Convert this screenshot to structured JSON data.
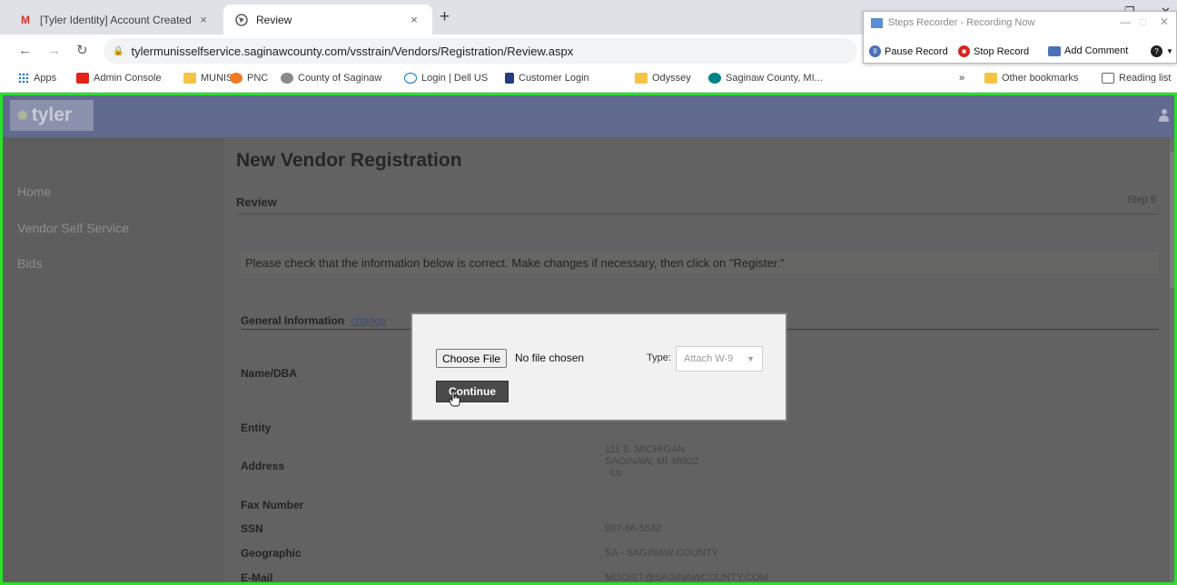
{
  "browser": {
    "tabs": [
      {
        "title": "[Tyler Identity] Account Created",
        "icon": "gmail-icon",
        "active": false
      },
      {
        "title": "Review",
        "icon": "globe-icon",
        "active": true
      }
    ],
    "new_tab_symbol": "+",
    "close_symbol": "×",
    "url": "tylermunisselfservice.saginawcounty.com/vsstrain/Vendors/Registration/Review.aspx",
    "bookmarks": [
      {
        "label": "Apps",
        "icon": "apps-grid-icon"
      },
      {
        "label": "Admin Console",
        "icon": "adobe-icon"
      },
      {
        "label": "MUNIS",
        "icon": "folder-icon"
      },
      {
        "label": "PNC",
        "icon": "pnc-icon"
      },
      {
        "label": "County of Saginaw",
        "icon": "county-seal-icon"
      },
      {
        "label": "Login | Dell US",
        "icon": "dell-icon"
      },
      {
        "label": "Customer Login",
        "icon": "paypal-icon"
      },
      {
        "label": "Odyssey",
        "icon": "folder-icon"
      },
      {
        "label": "Saginaw County, MI...",
        "icon": "sharepoint-icon"
      }
    ],
    "overflow_symbol": "»",
    "other_bookmarks": "Other bookmarks",
    "reading_list": "Reading list"
  },
  "recorder": {
    "title": "Steps Recorder - Recording Now",
    "buttons": [
      "Pause Record",
      "Stop Record",
      "Add Comment"
    ]
  },
  "app": {
    "logo_text": "tyler",
    "sidebar": [
      "Home",
      "Vendor Self Service",
      "Bids"
    ]
  },
  "page": {
    "heading": "New Vendor Registration",
    "subheading": "Review",
    "step": "Step 5",
    "notice": "Please check that the information below is correct. Make changes if necessary, then click on \"Register.\"",
    "section_title": "General Information",
    "change_link": "change",
    "fields": [
      {
        "label": "Name/DBA",
        "value": ""
      },
      {
        "label": "Entity",
        "value": ""
      },
      {
        "label": "Address",
        "value": "111 S. MICHIGAN"
      },
      {
        "label": "Fax Number",
        "value": ""
      },
      {
        "label": "SSN",
        "value": "987-66-5542"
      },
      {
        "label": "Geographic",
        "value": "SA - SAGINAW COUNTY"
      },
      {
        "label": "E-Mail",
        "value": "MGOIST@SAGINAWCOUNTY.COM"
      }
    ],
    "address_line2": "SAGINAW, MI 48602",
    "address_line3": ", Us"
  },
  "dialog": {
    "choose_file": "Choose File",
    "no_file": "No file chosen",
    "type_label": "Type:",
    "type_value": "Attach W-9",
    "continue": "Continue"
  }
}
